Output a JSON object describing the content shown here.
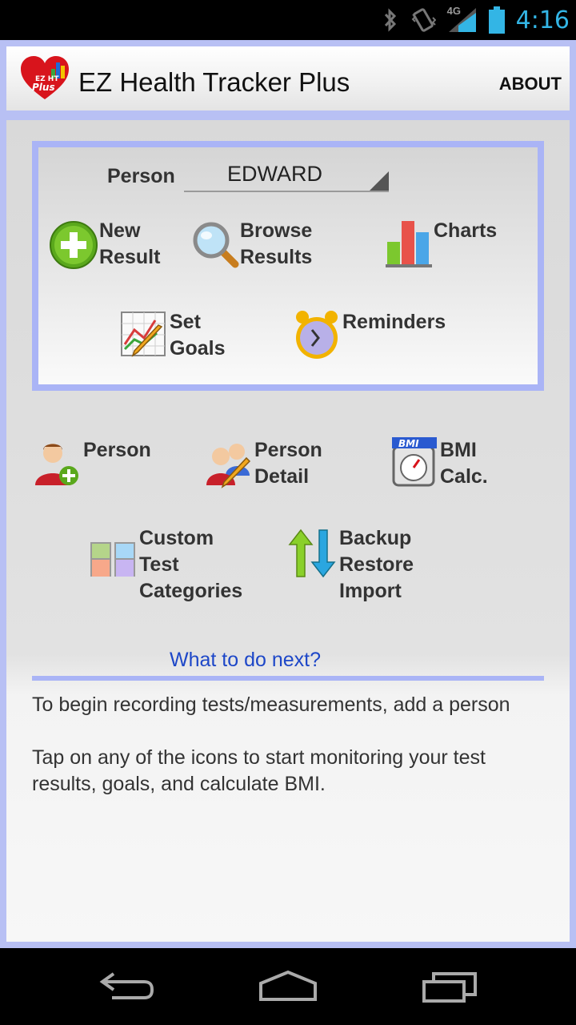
{
  "status_bar": {
    "network": "4G",
    "time": "4:16",
    "icons": [
      "bluetooth-icon",
      "vibrate-icon",
      "signal-icon",
      "battery-icon"
    ]
  },
  "action_bar": {
    "logo_text": "EZ HT Plus",
    "title": "EZ Health Tracker Plus",
    "about_label": "ABOUT"
  },
  "panel": {
    "person_label": "Person",
    "person_value": "EDWARD",
    "tiles": [
      {
        "label": "New\nResult",
        "icon": "add-circle-icon"
      },
      {
        "label": "Browse\nResults",
        "icon": "magnifier-icon"
      },
      {
        "label": "Charts",
        "icon": "bar-chart-icon"
      },
      {
        "label": "Set\nGoals",
        "icon": "goal-chart-pencil-icon"
      },
      {
        "label": "Reminders",
        "icon": "alarm-clock-icon"
      }
    ]
  },
  "tools": {
    "tiles": [
      {
        "label": "Person",
        "icon": "add-person-icon"
      },
      {
        "label": "Person\nDetail",
        "icon": "edit-persons-icon"
      },
      {
        "label": "BMI\nCalc.",
        "icon": "bmi-scale-icon",
        "icon_text": "BMI"
      },
      {
        "label": "Custom\nTest\nCategories",
        "icon": "categories-grid-icon"
      },
      {
        "label": "Backup\nRestore\nImport",
        "icon": "up-down-arrows-icon"
      }
    ]
  },
  "next": {
    "link": "What to do next?",
    "help": [
      "To begin recording tests/measurements, add a person",
      "Tap on any of the icons to start monitoring your test results, goals, and calculate BMI."
    ]
  },
  "nav_bar": {
    "buttons": [
      "back-icon",
      "home-icon",
      "recent-apps-icon"
    ]
  },
  "colors": {
    "accent_blue": "#33b5e5",
    "frame_blue": "#aab4f6",
    "link_blue": "#1d47c8"
  }
}
